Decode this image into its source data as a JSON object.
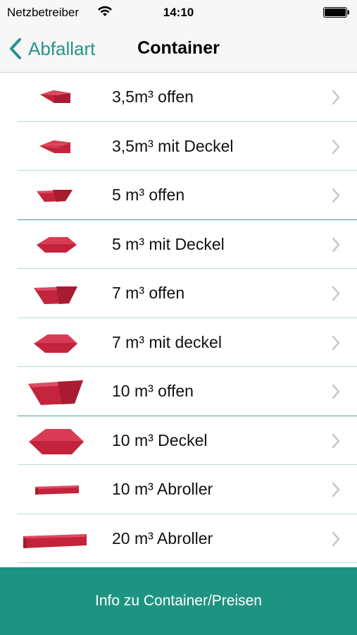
{
  "status_bar": {
    "carrier": "Netzbetreiber",
    "time": "14:10",
    "wifi_icon": "wifi-icon",
    "battery_icon": "battery-icon"
  },
  "nav": {
    "back_label": "Abfallart",
    "title": "Container",
    "accent_color": "#26948a"
  },
  "containers": [
    {
      "label": "3,5m³ offen",
      "icon": "skip-open-small-icon"
    },
    {
      "label": "3,5m³ mit Deckel",
      "icon": "skip-lid-small-icon"
    },
    {
      "label": "5 m³ offen",
      "icon": "skip-open-icon"
    },
    {
      "label": "5 m³ mit Deckel",
      "icon": "skip-lid-icon"
    },
    {
      "label": "7 m³ offen",
      "icon": "skip-open-icon"
    },
    {
      "label": "7 m³ mit deckel",
      "icon": "skip-lid-icon"
    },
    {
      "label": "10 m³ offen",
      "icon": "skip-open-large-icon"
    },
    {
      "label": "10 m³ Deckel",
      "icon": "skip-lid-large-icon"
    },
    {
      "label": "10 m³ Abroller",
      "icon": "roll-off-icon"
    },
    {
      "label": "20 m³ Abroller",
      "icon": "roll-off-large-icon"
    }
  ],
  "footer": {
    "info_button_label": "Info zu Container/Preisen",
    "button_color": "#1f9382"
  },
  "container_color": "#c4233c"
}
